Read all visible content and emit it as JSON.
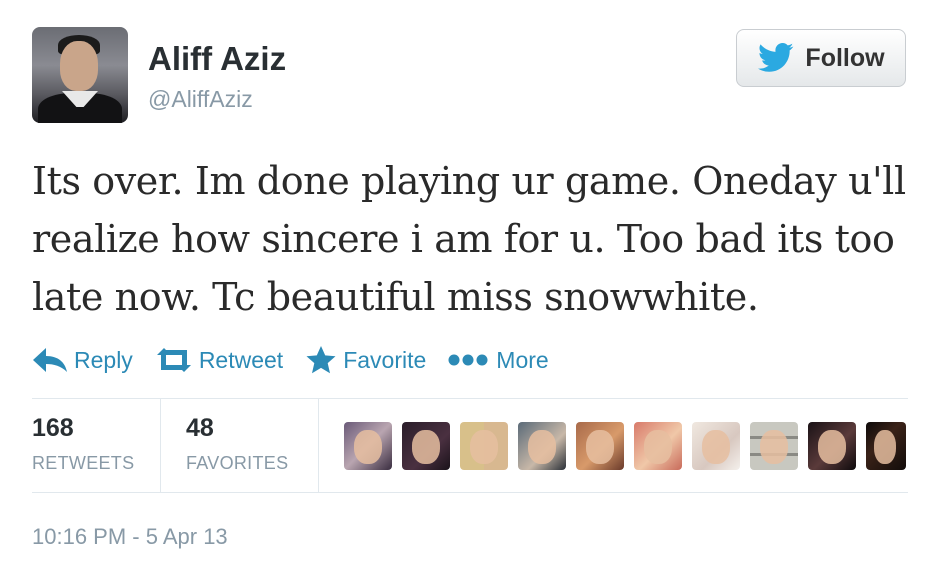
{
  "user": {
    "name": "Aliff Aziz",
    "handle": "@AliffAziz"
  },
  "follow_button": {
    "label": "Follow",
    "icon": "twitter-bird-icon"
  },
  "tweet": {
    "text": "Its over. Im done playing ur game. Oneday u'll realize how sincere i am for u. Too bad its too late now. Tc beautiful miss snowwhite."
  },
  "actions": [
    {
      "label": "Reply",
      "icon": "reply-icon"
    },
    {
      "label": "Retweet",
      "icon": "retweet-icon"
    },
    {
      "label": "Favorite",
      "icon": "star-icon"
    },
    {
      "label": "More",
      "icon": "more-dots-icon"
    }
  ],
  "stats": {
    "retweets": {
      "count": "168",
      "label": "RETWEETS"
    },
    "favorites": {
      "count": "48",
      "label": "FAVORITES"
    }
  },
  "favoriters_avatar_count": 9,
  "timestamp": "10:16 PM - 5 Apr 13",
  "colors": {
    "link": "#2c8ab6",
    "bird": "#2ba9e1",
    "muted": "#8899a6"
  }
}
